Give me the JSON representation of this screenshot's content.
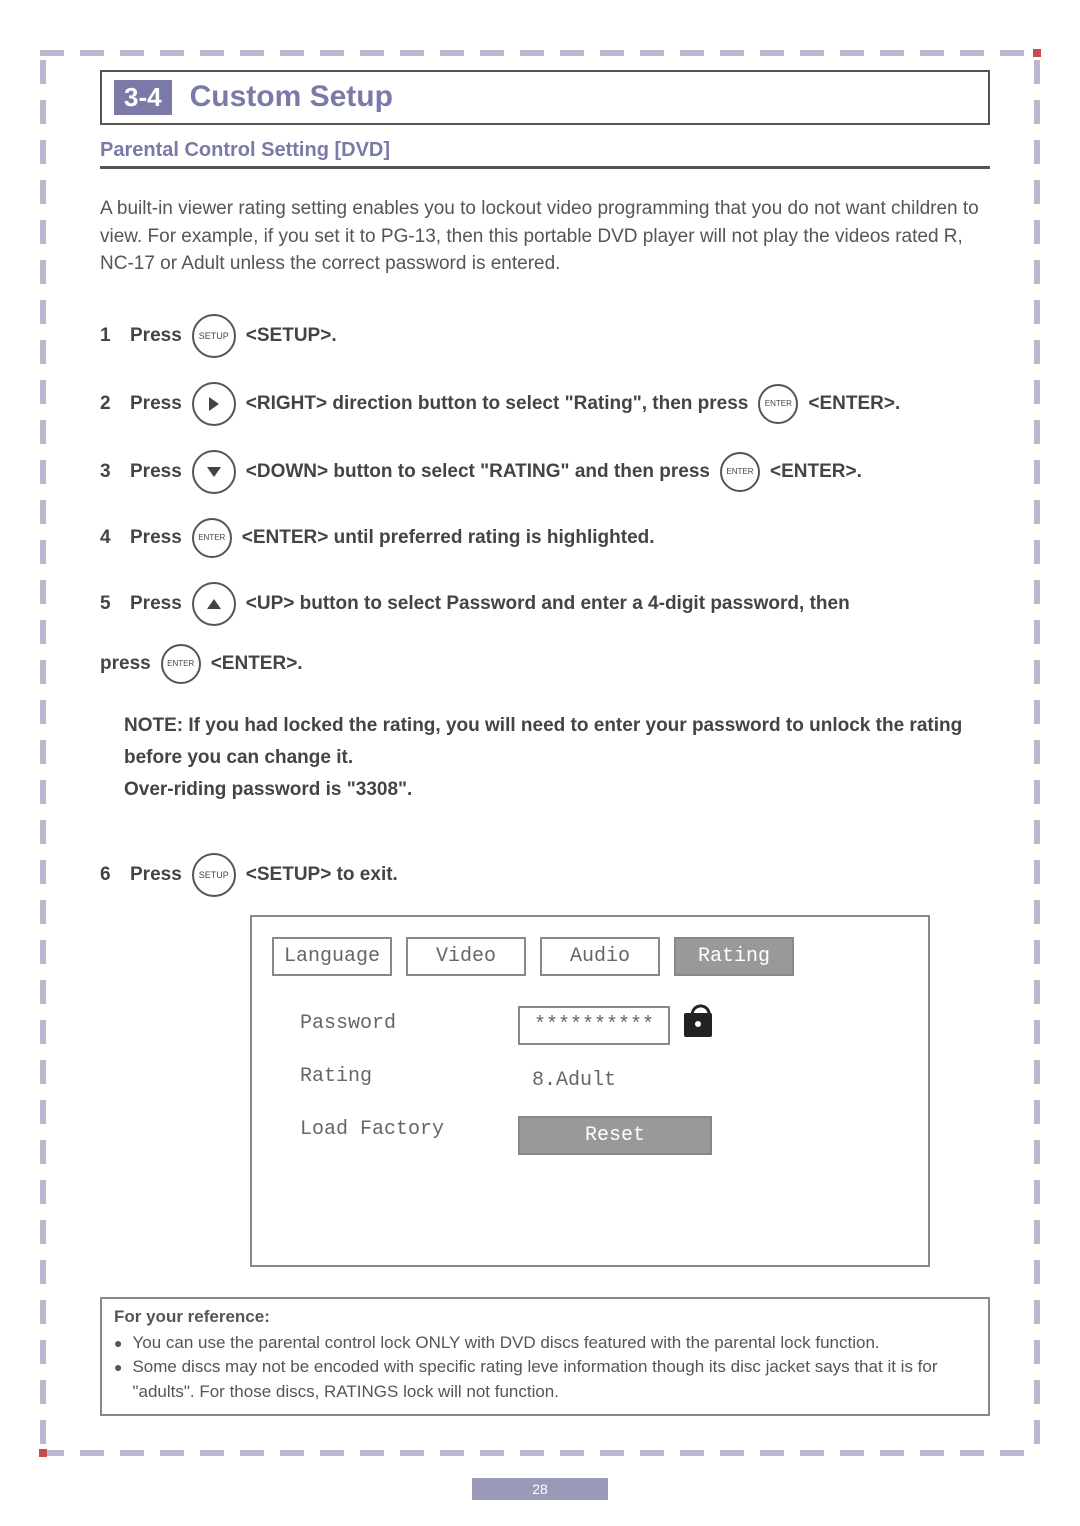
{
  "section_number": "3-4",
  "section_title": "Custom Setup",
  "subtitle": "Parental Control Setting [DVD]",
  "intro": "A built-in viewer rating setting enables you to lockout video programming that you do not want children to view. For example, if you set it to PG-13, then this portable DVD player will not play the videos rated R, NC-17 or Adult unless the correct password is entered.",
  "steps": [
    {
      "num": "1",
      "press": "Press",
      "key_label": "SETUP",
      "key_type": "text",
      "text": "<SETUP>."
    },
    {
      "num": "2",
      "press": "Press",
      "key_label": "right-arrow",
      "key_type": "arrow-right",
      "text_a": "<RIGHT> direction button to select \"Rating\",   then press",
      "key2_label": "ENTER",
      "text_b": "<ENTER>."
    },
    {
      "num": "3",
      "press": "Press",
      "key_label": "down-arrow",
      "key_type": "arrow-down",
      "text_a": "<DOWN> button to select \"RATING\" and then press",
      "key2_label": "ENTER",
      "text_b": "<ENTER>."
    },
    {
      "num": "4",
      "press": "Press",
      "key_label": "ENTER",
      "key_type": "text",
      "text": "<ENTER> until preferred rating is highlighted."
    },
    {
      "num": "5",
      "press": "Press",
      "key_label": "up-arrow",
      "key_type": "arrow-up",
      "text_a": "<UP> button to select Password and enter a 4-digit password, then",
      "press2": "press",
      "key2_label": "ENTER",
      "text_b": "<ENTER>."
    },
    {
      "num": "6",
      "press": "Press",
      "key_label": "SETUP",
      "key_type": "text",
      "text": "<SETUP> to exit."
    }
  ],
  "note_lines": [
    "NOTE: If you had locked the rating, you will need to enter your password to unlock the rating before you can change it.",
    "Over-riding password is \"3308\"."
  ],
  "osd": {
    "tabs": [
      "Language",
      "Video",
      "Audio",
      "Rating"
    ],
    "selected_tab_index": 3,
    "left_col": [
      "Password",
      "Rating",
      "Load Factory"
    ],
    "right_col": [
      {
        "text": "**********",
        "style": "box"
      },
      {
        "text": "8.Adult",
        "style": "plain"
      },
      {
        "text": "Reset",
        "style": "sel"
      }
    ],
    "has_lock_icon": true
  },
  "reference": {
    "title": "For your reference:",
    "items": [
      "You can use the parental control lock ONLY with DVD discs featured with the parental lock function.",
      "Some discs may not be encoded with specific rating leve information though its disc jacket says that it is for \"adults\". For those discs, RATINGS lock will not function."
    ]
  },
  "page_number": "28"
}
